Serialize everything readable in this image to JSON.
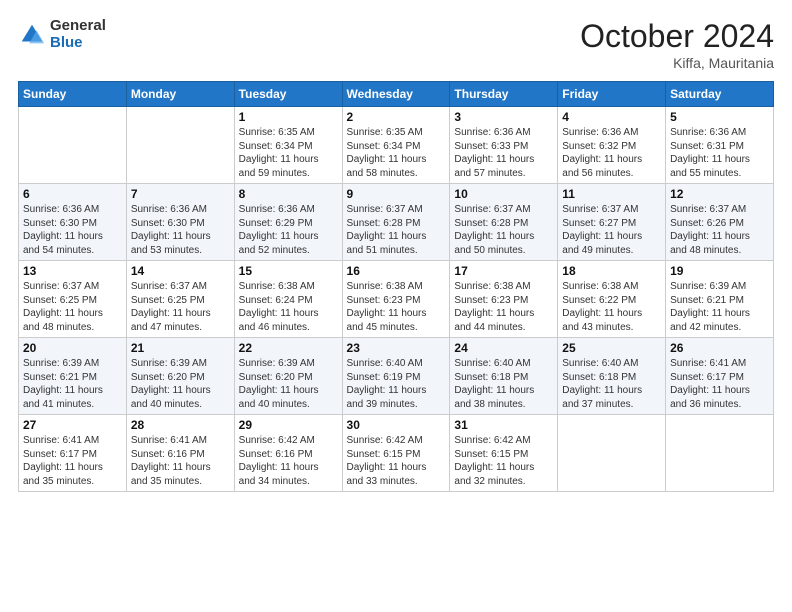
{
  "logo": {
    "general": "General",
    "blue": "Blue"
  },
  "title": "October 2024",
  "location": "Kiffa, Mauritania",
  "days_of_week": [
    "Sunday",
    "Monday",
    "Tuesday",
    "Wednesday",
    "Thursday",
    "Friday",
    "Saturday"
  ],
  "weeks": [
    [
      {
        "day": "",
        "info": ""
      },
      {
        "day": "",
        "info": ""
      },
      {
        "day": "1",
        "info": "Sunrise: 6:35 AM\nSunset: 6:34 PM\nDaylight: 11 hours and 59 minutes."
      },
      {
        "day": "2",
        "info": "Sunrise: 6:35 AM\nSunset: 6:34 PM\nDaylight: 11 hours and 58 minutes."
      },
      {
        "day": "3",
        "info": "Sunrise: 6:36 AM\nSunset: 6:33 PM\nDaylight: 11 hours and 57 minutes."
      },
      {
        "day": "4",
        "info": "Sunrise: 6:36 AM\nSunset: 6:32 PM\nDaylight: 11 hours and 56 minutes."
      },
      {
        "day": "5",
        "info": "Sunrise: 6:36 AM\nSunset: 6:31 PM\nDaylight: 11 hours and 55 minutes."
      }
    ],
    [
      {
        "day": "6",
        "info": "Sunrise: 6:36 AM\nSunset: 6:30 PM\nDaylight: 11 hours and 54 minutes."
      },
      {
        "day": "7",
        "info": "Sunrise: 6:36 AM\nSunset: 6:30 PM\nDaylight: 11 hours and 53 minutes."
      },
      {
        "day": "8",
        "info": "Sunrise: 6:36 AM\nSunset: 6:29 PM\nDaylight: 11 hours and 52 minutes."
      },
      {
        "day": "9",
        "info": "Sunrise: 6:37 AM\nSunset: 6:28 PM\nDaylight: 11 hours and 51 minutes."
      },
      {
        "day": "10",
        "info": "Sunrise: 6:37 AM\nSunset: 6:28 PM\nDaylight: 11 hours and 50 minutes."
      },
      {
        "day": "11",
        "info": "Sunrise: 6:37 AM\nSunset: 6:27 PM\nDaylight: 11 hours and 49 minutes."
      },
      {
        "day": "12",
        "info": "Sunrise: 6:37 AM\nSunset: 6:26 PM\nDaylight: 11 hours and 48 minutes."
      }
    ],
    [
      {
        "day": "13",
        "info": "Sunrise: 6:37 AM\nSunset: 6:25 PM\nDaylight: 11 hours and 48 minutes."
      },
      {
        "day": "14",
        "info": "Sunrise: 6:37 AM\nSunset: 6:25 PM\nDaylight: 11 hours and 47 minutes."
      },
      {
        "day": "15",
        "info": "Sunrise: 6:38 AM\nSunset: 6:24 PM\nDaylight: 11 hours and 46 minutes."
      },
      {
        "day": "16",
        "info": "Sunrise: 6:38 AM\nSunset: 6:23 PM\nDaylight: 11 hours and 45 minutes."
      },
      {
        "day": "17",
        "info": "Sunrise: 6:38 AM\nSunset: 6:23 PM\nDaylight: 11 hours and 44 minutes."
      },
      {
        "day": "18",
        "info": "Sunrise: 6:38 AM\nSunset: 6:22 PM\nDaylight: 11 hours and 43 minutes."
      },
      {
        "day": "19",
        "info": "Sunrise: 6:39 AM\nSunset: 6:21 PM\nDaylight: 11 hours and 42 minutes."
      }
    ],
    [
      {
        "day": "20",
        "info": "Sunrise: 6:39 AM\nSunset: 6:21 PM\nDaylight: 11 hours and 41 minutes."
      },
      {
        "day": "21",
        "info": "Sunrise: 6:39 AM\nSunset: 6:20 PM\nDaylight: 11 hours and 40 minutes."
      },
      {
        "day": "22",
        "info": "Sunrise: 6:39 AM\nSunset: 6:20 PM\nDaylight: 11 hours and 40 minutes."
      },
      {
        "day": "23",
        "info": "Sunrise: 6:40 AM\nSunset: 6:19 PM\nDaylight: 11 hours and 39 minutes."
      },
      {
        "day": "24",
        "info": "Sunrise: 6:40 AM\nSunset: 6:18 PM\nDaylight: 11 hours and 38 minutes."
      },
      {
        "day": "25",
        "info": "Sunrise: 6:40 AM\nSunset: 6:18 PM\nDaylight: 11 hours and 37 minutes."
      },
      {
        "day": "26",
        "info": "Sunrise: 6:41 AM\nSunset: 6:17 PM\nDaylight: 11 hours and 36 minutes."
      }
    ],
    [
      {
        "day": "27",
        "info": "Sunrise: 6:41 AM\nSunset: 6:17 PM\nDaylight: 11 hours and 35 minutes."
      },
      {
        "day": "28",
        "info": "Sunrise: 6:41 AM\nSunset: 6:16 PM\nDaylight: 11 hours and 35 minutes."
      },
      {
        "day": "29",
        "info": "Sunrise: 6:42 AM\nSunset: 6:16 PM\nDaylight: 11 hours and 34 minutes."
      },
      {
        "day": "30",
        "info": "Sunrise: 6:42 AM\nSunset: 6:15 PM\nDaylight: 11 hours and 33 minutes."
      },
      {
        "day": "31",
        "info": "Sunrise: 6:42 AM\nSunset: 6:15 PM\nDaylight: 11 hours and 32 minutes."
      },
      {
        "day": "",
        "info": ""
      },
      {
        "day": "",
        "info": ""
      }
    ]
  ]
}
